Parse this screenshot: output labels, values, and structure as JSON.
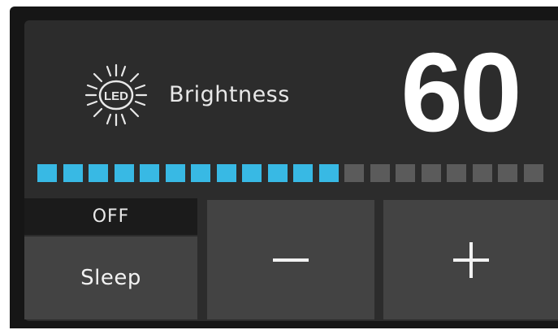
{
  "brightness": {
    "label": "Brightness",
    "value": "60",
    "icon": "led-sun-icon",
    "icon_text": "LED"
  },
  "level_bar": {
    "total_segments": 20,
    "lit_segments": 12,
    "lit_color": "#38b9e4",
    "unlit_color": "#5b5b5b"
  },
  "controls": {
    "sleep_status": "OFF",
    "sleep_label": "Sleep",
    "decrease_symbol": "minus-icon",
    "increase_symbol": "plus-icon"
  }
}
